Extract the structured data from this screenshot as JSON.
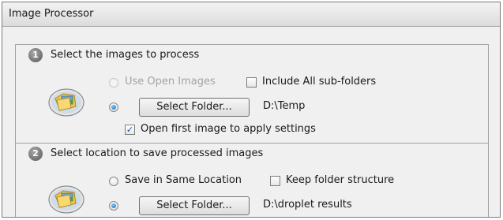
{
  "window": {
    "title": "Image Processor"
  },
  "section1": {
    "number": "1",
    "title": "Select the images to process",
    "use_open_images_label": "Use Open Images",
    "include_subfolders_label": "Include All sub-folders",
    "select_folder_button": "Select Folder...",
    "folder_path": "D:\\Temp",
    "open_first_image_label": "Open first image to apply settings",
    "use_open_images_enabled": false,
    "select_folder_selected": true,
    "open_first_image_checked": true,
    "include_subfolders_checked": false,
    "icon": "folder-images-icon"
  },
  "section2": {
    "number": "2",
    "title": "Select location to save processed images",
    "save_same_location_label": "Save in Same Location",
    "keep_folder_structure_label": "Keep folder structure",
    "select_folder_button": "Select Folder...",
    "folder_path": "D:\\droplet results",
    "save_same_location_selected": false,
    "select_folder_selected": true,
    "keep_folder_structure_checked": false,
    "icon": "folder-images-icon"
  }
}
